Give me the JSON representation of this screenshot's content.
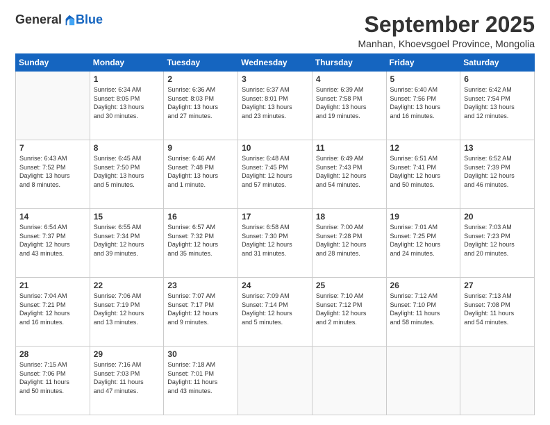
{
  "logo": {
    "general": "General",
    "blue": "Blue"
  },
  "title": "September 2025",
  "location": "Manhan, Khoevsgoel Province, Mongolia",
  "days_of_week": [
    "Sunday",
    "Monday",
    "Tuesday",
    "Wednesday",
    "Thursday",
    "Friday",
    "Saturday"
  ],
  "weeks": [
    [
      {
        "day": "",
        "content": ""
      },
      {
        "day": "1",
        "content": "Sunrise: 6:34 AM\nSunset: 8:05 PM\nDaylight: 13 hours\nand 30 minutes."
      },
      {
        "day": "2",
        "content": "Sunrise: 6:36 AM\nSunset: 8:03 PM\nDaylight: 13 hours\nand 27 minutes."
      },
      {
        "day": "3",
        "content": "Sunrise: 6:37 AM\nSunset: 8:01 PM\nDaylight: 13 hours\nand 23 minutes."
      },
      {
        "day": "4",
        "content": "Sunrise: 6:39 AM\nSunset: 7:58 PM\nDaylight: 13 hours\nand 19 minutes."
      },
      {
        "day": "5",
        "content": "Sunrise: 6:40 AM\nSunset: 7:56 PM\nDaylight: 13 hours\nand 16 minutes."
      },
      {
        "day": "6",
        "content": "Sunrise: 6:42 AM\nSunset: 7:54 PM\nDaylight: 13 hours\nand 12 minutes."
      }
    ],
    [
      {
        "day": "7",
        "content": "Sunrise: 6:43 AM\nSunset: 7:52 PM\nDaylight: 13 hours\nand 8 minutes."
      },
      {
        "day": "8",
        "content": "Sunrise: 6:45 AM\nSunset: 7:50 PM\nDaylight: 13 hours\nand 5 minutes."
      },
      {
        "day": "9",
        "content": "Sunrise: 6:46 AM\nSunset: 7:48 PM\nDaylight: 13 hours\nand 1 minute."
      },
      {
        "day": "10",
        "content": "Sunrise: 6:48 AM\nSunset: 7:45 PM\nDaylight: 12 hours\nand 57 minutes."
      },
      {
        "day": "11",
        "content": "Sunrise: 6:49 AM\nSunset: 7:43 PM\nDaylight: 12 hours\nand 54 minutes."
      },
      {
        "day": "12",
        "content": "Sunrise: 6:51 AM\nSunset: 7:41 PM\nDaylight: 12 hours\nand 50 minutes."
      },
      {
        "day": "13",
        "content": "Sunrise: 6:52 AM\nSunset: 7:39 PM\nDaylight: 12 hours\nand 46 minutes."
      }
    ],
    [
      {
        "day": "14",
        "content": "Sunrise: 6:54 AM\nSunset: 7:37 PM\nDaylight: 12 hours\nand 43 minutes."
      },
      {
        "day": "15",
        "content": "Sunrise: 6:55 AM\nSunset: 7:34 PM\nDaylight: 12 hours\nand 39 minutes."
      },
      {
        "day": "16",
        "content": "Sunrise: 6:57 AM\nSunset: 7:32 PM\nDaylight: 12 hours\nand 35 minutes."
      },
      {
        "day": "17",
        "content": "Sunrise: 6:58 AM\nSunset: 7:30 PM\nDaylight: 12 hours\nand 31 minutes."
      },
      {
        "day": "18",
        "content": "Sunrise: 7:00 AM\nSunset: 7:28 PM\nDaylight: 12 hours\nand 28 minutes."
      },
      {
        "day": "19",
        "content": "Sunrise: 7:01 AM\nSunset: 7:25 PM\nDaylight: 12 hours\nand 24 minutes."
      },
      {
        "day": "20",
        "content": "Sunrise: 7:03 AM\nSunset: 7:23 PM\nDaylight: 12 hours\nand 20 minutes."
      }
    ],
    [
      {
        "day": "21",
        "content": "Sunrise: 7:04 AM\nSunset: 7:21 PM\nDaylight: 12 hours\nand 16 minutes."
      },
      {
        "day": "22",
        "content": "Sunrise: 7:06 AM\nSunset: 7:19 PM\nDaylight: 12 hours\nand 13 minutes."
      },
      {
        "day": "23",
        "content": "Sunrise: 7:07 AM\nSunset: 7:17 PM\nDaylight: 12 hours\nand 9 minutes."
      },
      {
        "day": "24",
        "content": "Sunrise: 7:09 AM\nSunset: 7:14 PM\nDaylight: 12 hours\nand 5 minutes."
      },
      {
        "day": "25",
        "content": "Sunrise: 7:10 AM\nSunset: 7:12 PM\nDaylight: 12 hours\nand 2 minutes."
      },
      {
        "day": "26",
        "content": "Sunrise: 7:12 AM\nSunset: 7:10 PM\nDaylight: 11 hours\nand 58 minutes."
      },
      {
        "day": "27",
        "content": "Sunrise: 7:13 AM\nSunset: 7:08 PM\nDaylight: 11 hours\nand 54 minutes."
      }
    ],
    [
      {
        "day": "28",
        "content": "Sunrise: 7:15 AM\nSunset: 7:06 PM\nDaylight: 11 hours\nand 50 minutes."
      },
      {
        "day": "29",
        "content": "Sunrise: 7:16 AM\nSunset: 7:03 PM\nDaylight: 11 hours\nand 47 minutes."
      },
      {
        "day": "30",
        "content": "Sunrise: 7:18 AM\nSunset: 7:01 PM\nDaylight: 11 hours\nand 43 minutes."
      },
      {
        "day": "",
        "content": ""
      },
      {
        "day": "",
        "content": ""
      },
      {
        "day": "",
        "content": ""
      },
      {
        "day": "",
        "content": ""
      }
    ]
  ]
}
